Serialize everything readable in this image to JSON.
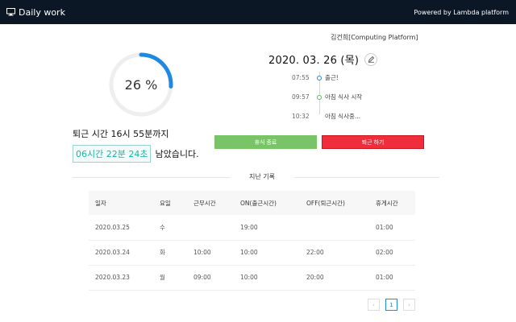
{
  "header": {
    "app_title": "Daily work",
    "powered_by": "Powered by Lambda platform"
  },
  "progress": {
    "percent_value": 26,
    "percent_label": "26 %"
  },
  "summary": {
    "leave_time_text": "퇴근 시간 16시 55분까지",
    "remaining": "06시간 22분 24초",
    "remaining_suffix": "남았습니다."
  },
  "user": {
    "name": "김건희[Computing Platform]"
  },
  "today": {
    "date": "2020. 03. 26 (목)"
  },
  "timeline": [
    {
      "time": "07:55",
      "label": "출근!",
      "dot": "blue"
    },
    {
      "time": "09:57",
      "label": "아침 식사 시작",
      "dot": "green"
    },
    {
      "time": "10:32",
      "label": "아침 식사중...",
      "dot": "none"
    }
  ],
  "actions": {
    "rest_end_label": "휴식 종료",
    "leave_label": "퇴근 하기"
  },
  "history": {
    "title": "지난 기록",
    "columns": [
      "일자",
      "요일",
      "근무시간",
      "ON(출근시간)",
      "OFF(퇴근시간)",
      "휴게시간"
    ],
    "rows": [
      [
        "2020.03.25",
        "수",
        "",
        "19:00",
        "",
        "01:00"
      ],
      [
        "2020.03.24",
        "화",
        "10:00",
        "10:00",
        "22:00",
        "02:00"
      ],
      [
        "2020.03.23",
        "월",
        "09:00",
        "10:00",
        "20:00",
        "01:00"
      ]
    ]
  },
  "pagination": {
    "prev": "‹",
    "current_page": "1",
    "next": "›"
  },
  "colors": {
    "navbar": "#0c1726",
    "gauge_fill": "#1e88e5",
    "gauge_track": "#eeeeee",
    "remaining_text": "#19b5a5",
    "rest_button": "#78c466",
    "leave_button": "#f02d3a"
  },
  "icons": {
    "brand": "monitor-icon",
    "edit": "pencil-icon"
  }
}
